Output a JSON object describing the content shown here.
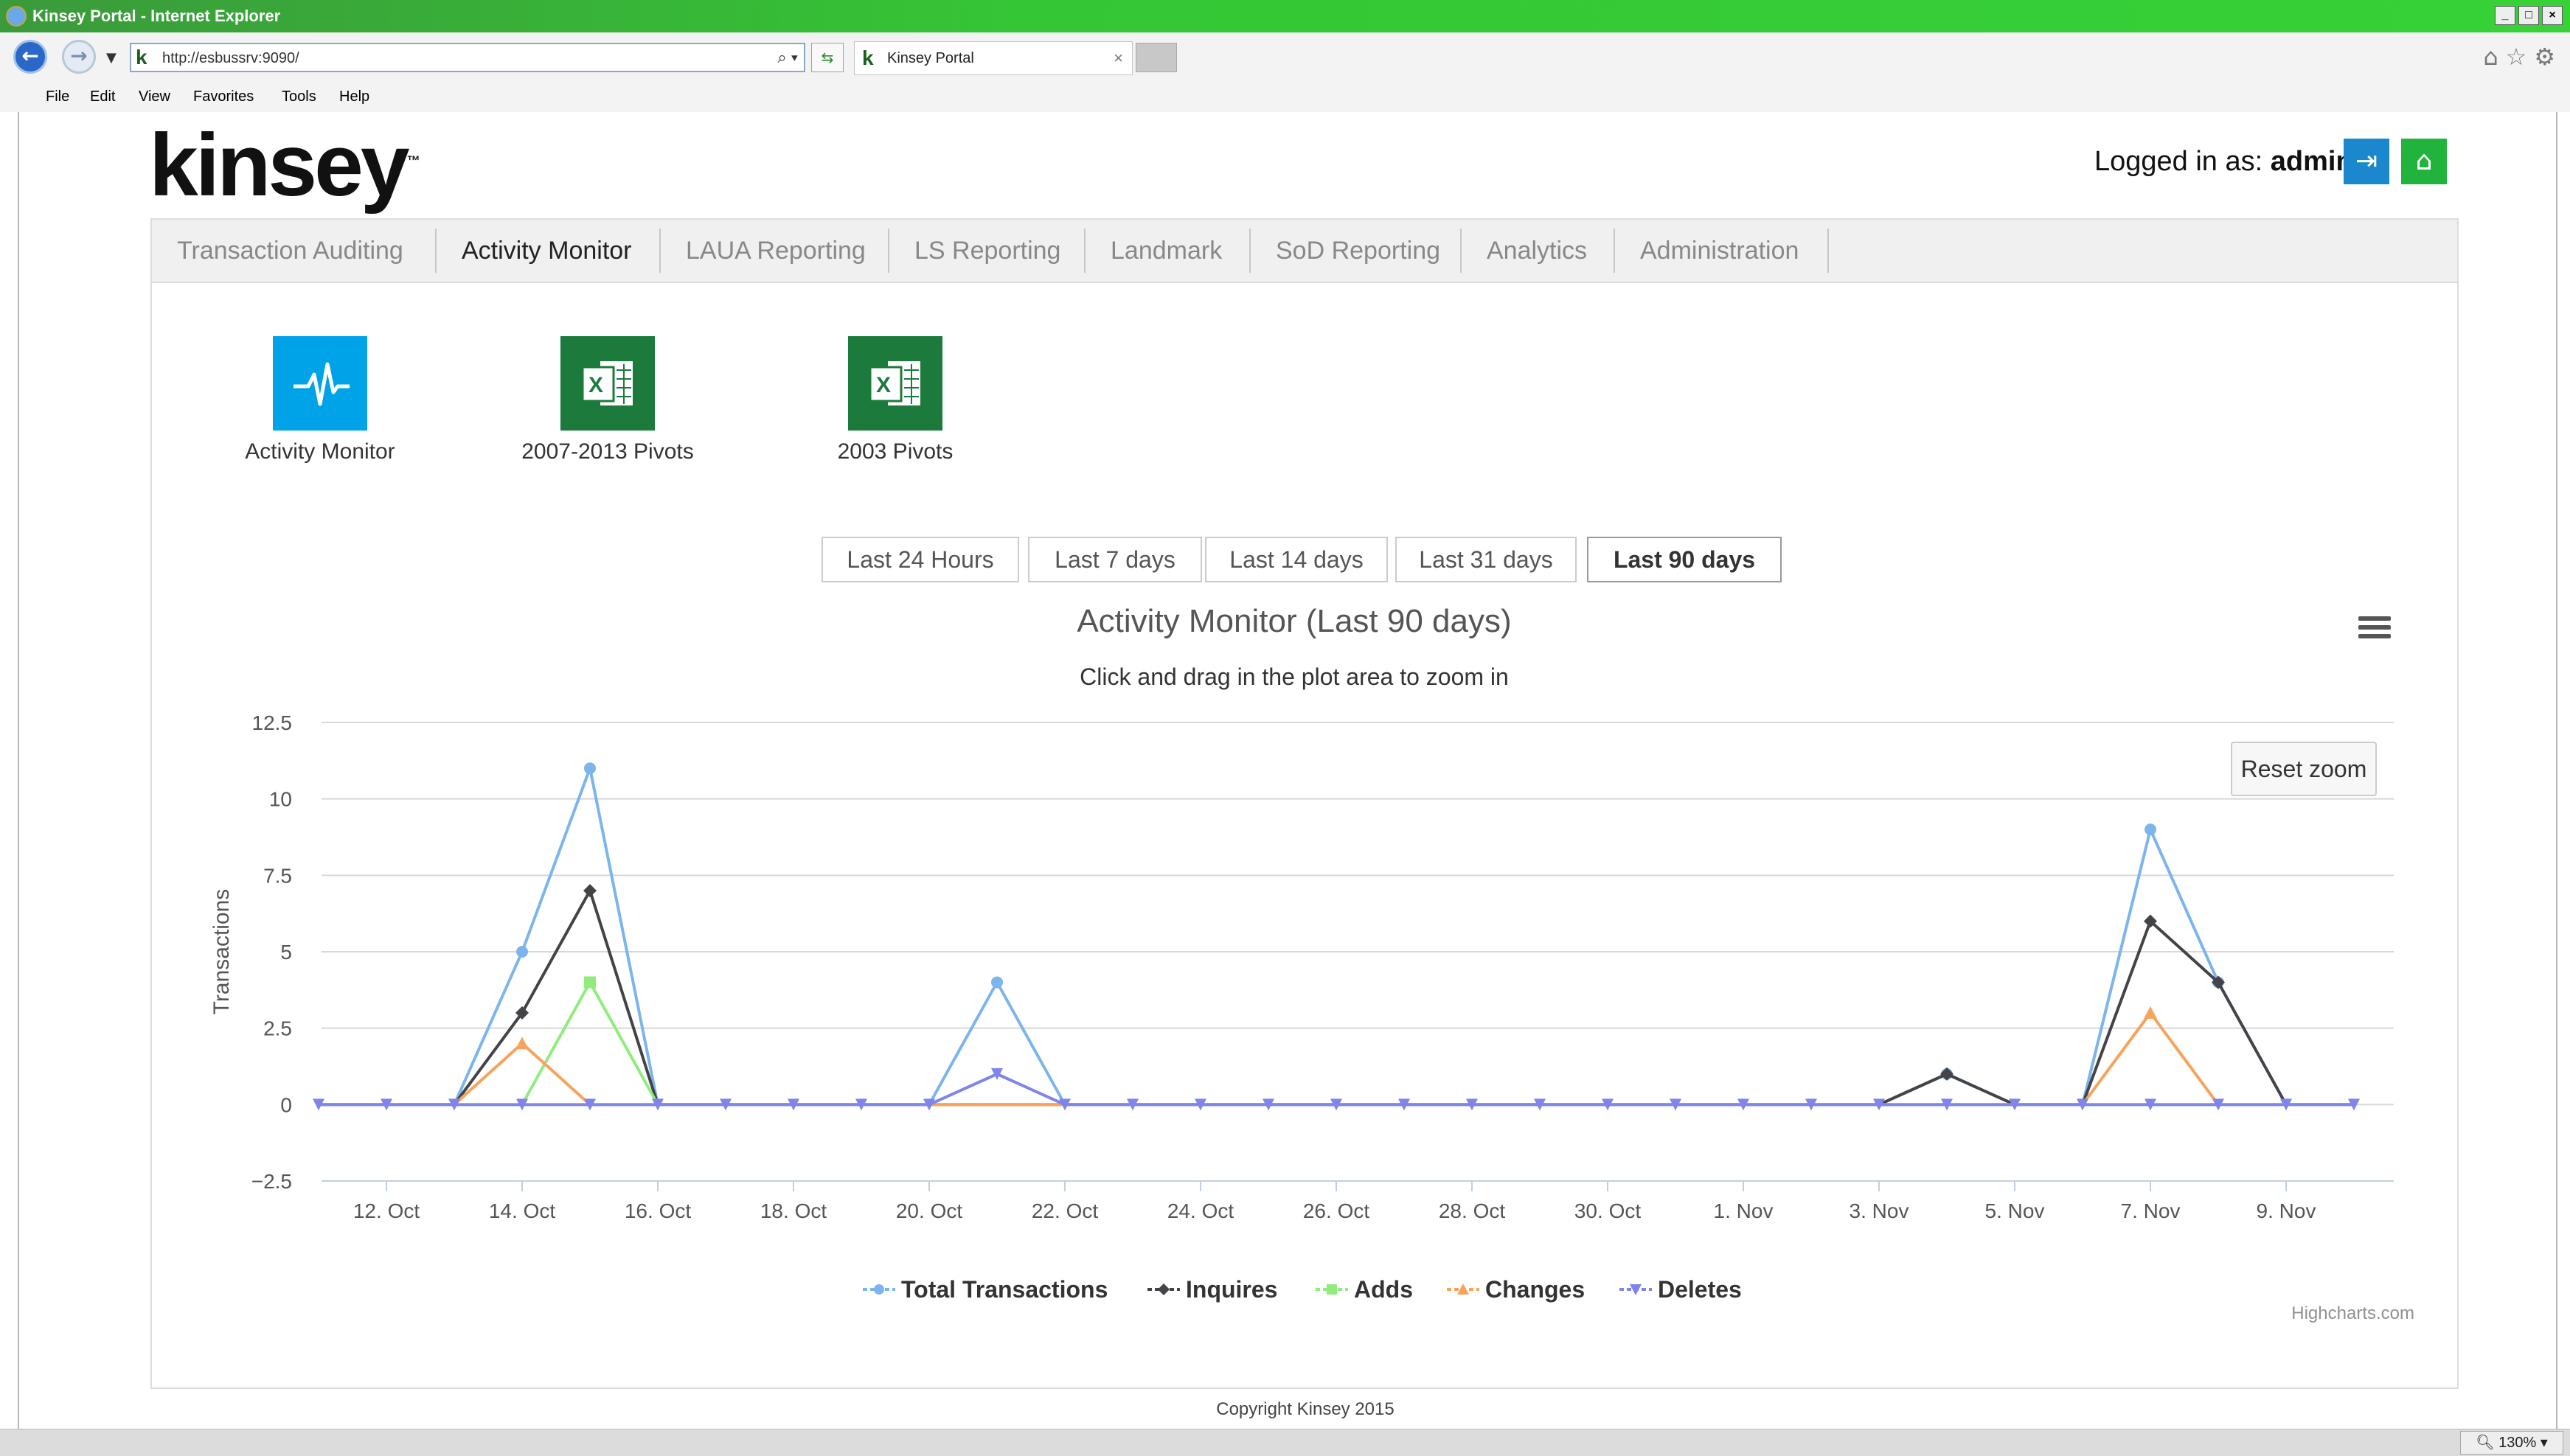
{
  "browser": {
    "window_title": "Kinsey Portal - Internet Explorer",
    "url": "http://esbussrv:9090/",
    "tab_title": "Kinsey Portal",
    "menu": [
      "File",
      "Edit",
      "View",
      "Favorites",
      "Tools",
      "Help"
    ],
    "zoom": "130%"
  },
  "header": {
    "logo": "kinsey",
    "logged_in_label": "Logged in as:",
    "username": "admin"
  },
  "nav": {
    "tabs": [
      "Transaction Auditing",
      "Activity Monitor",
      "LAUA Reporting",
      "LS Reporting",
      "Landmark",
      "SoD Reporting",
      "Analytics",
      "Administration"
    ],
    "active": "Activity Monitor"
  },
  "tiles": [
    {
      "label": "Activity Monitor",
      "icon": "pulse-icon"
    },
    {
      "label": "2007-2013 Pivots",
      "icon": "excel-icon"
    },
    {
      "label": "2003 Pivots",
      "icon": "excel-icon"
    }
  ],
  "ranges": [
    "Last 24 Hours",
    "Last 7 days",
    "Last 14 days",
    "Last 31 days",
    "Last 90 days"
  ],
  "active_range": "Last 90 days",
  "reset_zoom": "Reset zoom",
  "credits": "Highcharts.com",
  "footer": "Copyright Kinsey 2015",
  "colors": {
    "total": "#7cb5ec",
    "inquires": "#434348",
    "adds": "#90ed7d",
    "changes": "#f7a35c",
    "deletes": "#8085e9",
    "activity_tile": "#00a3e8",
    "excel_tile": "#1d7a3d",
    "logout_button": "#1b87cc",
    "home_button": "#22b33c"
  },
  "chart_data": {
    "type": "line",
    "title": "Activity Monitor (Last 90 days)",
    "subtitle": "Click and drag in the plot area to zoom in",
    "ylabel": "Transactions",
    "xlabel": "",
    "ylim": [
      -2.5,
      12.5
    ],
    "yticks": [
      "−2.5",
      "0",
      "2.5",
      "5",
      "7.5",
      "10",
      "12.5"
    ],
    "yticks_values": [
      -2.5,
      0,
      2.5,
      5,
      7.5,
      10,
      12.5
    ],
    "xticks": [
      "12. Oct",
      "14. Oct",
      "16. Oct",
      "18. Oct",
      "20. Oct",
      "22. Oct",
      "24. Oct",
      "26. Oct",
      "28. Oct",
      "30. Oct",
      "1. Nov",
      "3. Nov",
      "5. Nov",
      "7. Nov",
      "9. Nov"
    ],
    "grid": true,
    "legend_position": "bottom",
    "x": [
      "11. Oct",
      "12. Oct",
      "13. Oct",
      "14. Oct",
      "15. Oct",
      "16. Oct",
      "17. Oct",
      "18. Oct",
      "19. Oct",
      "20. Oct",
      "21. Oct",
      "22. Oct",
      "23. Oct",
      "24. Oct",
      "25. Oct",
      "26. Oct",
      "27. Oct",
      "28. Oct",
      "29. Oct",
      "30. Oct",
      "31. Oct",
      "1. Nov",
      "2. Nov",
      "3. Nov",
      "4. Nov",
      "5. Nov",
      "6. Nov",
      "7. Nov",
      "8. Nov",
      "9. Nov",
      "10. Nov"
    ],
    "series": [
      {
        "name": "Total Transactions",
        "marker": "circle",
        "values": [
          0,
          0,
          0,
          5,
          11,
          0,
          0,
          0,
          0,
          0,
          4,
          0,
          0,
          0,
          0,
          0,
          0,
          0,
          0,
          0,
          0,
          0,
          0,
          0,
          1,
          0,
          0,
          9,
          4,
          0,
          0
        ]
      },
      {
        "name": "Inquires",
        "marker": "diamond",
        "values": [
          0,
          0,
          0,
          3,
          7,
          0,
          0,
          0,
          0,
          0,
          0,
          0,
          0,
          0,
          0,
          0,
          0,
          0,
          0,
          0,
          0,
          0,
          0,
          0,
          1,
          0,
          0,
          6,
          4,
          0,
          0
        ]
      },
      {
        "name": "Adds",
        "marker": "square",
        "values": [
          0,
          0,
          0,
          0,
          4,
          0,
          0,
          0,
          0,
          0,
          0,
          0,
          0,
          0,
          0,
          0,
          0,
          0,
          0,
          0,
          0,
          0,
          0,
          0,
          0,
          0,
          0,
          0,
          0,
          0,
          0
        ]
      },
      {
        "name": "Changes",
        "marker": "triangle",
        "values": [
          0,
          0,
          0,
          2,
          0,
          0,
          0,
          0,
          0,
          0,
          0,
          0,
          0,
          0,
          0,
          0,
          0,
          0,
          0,
          0,
          0,
          0,
          0,
          0,
          0,
          0,
          0,
          3,
          0,
          0,
          0
        ]
      },
      {
        "name": "Deletes",
        "marker": "triangle-down",
        "values": [
          0,
          0,
          0,
          0,
          0,
          0,
          0,
          0,
          0,
          0,
          1,
          0,
          0,
          0,
          0,
          0,
          0,
          0,
          0,
          0,
          0,
          0,
          0,
          0,
          0,
          0,
          0,
          0,
          0,
          0,
          0
        ]
      }
    ]
  }
}
